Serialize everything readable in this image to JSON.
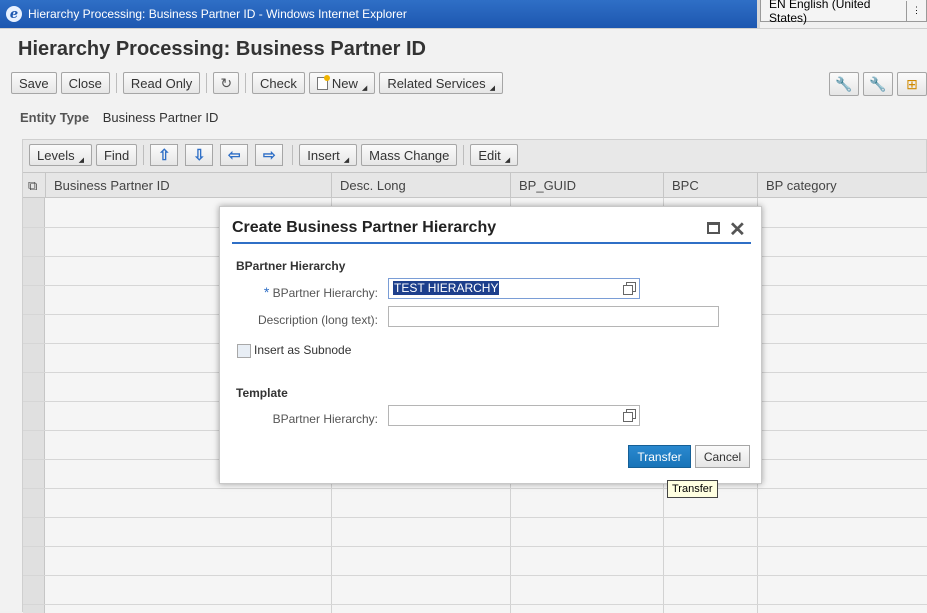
{
  "window": {
    "title": "Hierarchy Processing: Business Partner ID - Windows Internet Explorer",
    "language": "EN English (United States)"
  },
  "page": {
    "title": "Hierarchy Processing: Business Partner ID"
  },
  "toolbar": {
    "save": "Save",
    "close": "Close",
    "read_only": "Read Only",
    "check": "Check",
    "new": "New",
    "related_services": "Related Services"
  },
  "entity": {
    "label": "Entity Type",
    "value": "Business Partner ID"
  },
  "table_toolbar": {
    "levels": "Levels",
    "find": "Find",
    "insert": "Insert",
    "mass_change": "Mass Change",
    "edit": "Edit"
  },
  "table": {
    "columns": [
      "Business Partner ID",
      "Desc. Long",
      "BP_GUID",
      "BPC",
      "BP category"
    ]
  },
  "dialog": {
    "title": "Create Business Partner Hierarchy",
    "section1": "BPartner Hierarchy",
    "hierarchy_label": "BPartner Hierarchy:",
    "hierarchy_value": "TEST HIERARCHY",
    "description_label": "Description (long text):",
    "description_value": "",
    "subnode_label": "Insert as Subnode",
    "subnode_checked": false,
    "section2": "Template",
    "template_label": "BPartner Hierarchy:",
    "template_value": "",
    "transfer": "Transfer",
    "cancel": "Cancel",
    "required_marker": "*"
  },
  "tooltip": {
    "text": "Transfer"
  },
  "colors": {
    "accent": "#2f6fc6",
    "primary_button": "#1874b8"
  }
}
